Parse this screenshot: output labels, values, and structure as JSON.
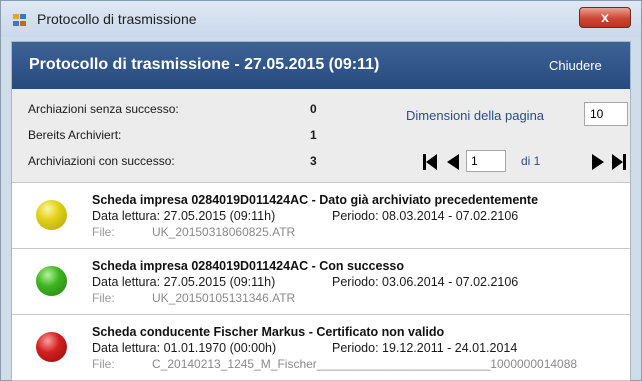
{
  "window": {
    "title": "Protocollo di trasmissione",
    "close_glyph": "x"
  },
  "header": {
    "title": "Protocollo di trasmissione - 27.05.2015 (09:11)",
    "close_label": "Chiudere"
  },
  "summary": {
    "stats": [
      {
        "label": "Archiazioni senza successo:",
        "value": "0"
      },
      {
        "label": "Bereits Archiviert:",
        "value": "1"
      },
      {
        "label": "Archiviazioni con successo:",
        "value": "3"
      }
    ],
    "page_size_label": "Dimensioni della pagina",
    "page_size_value": "10",
    "page_current": "1",
    "page_of": "di 1"
  },
  "entries": [
    {
      "status": "yellow",
      "title": "Scheda impresa 0284019D011424AC - Dato già archiviato precedentemente",
      "date": "Data lettura: 27.05.2015 (09:11h)",
      "period": "Periodo:  08.03.2014 - 07.02.2106",
      "file_label": "File:",
      "file": "UK_20150318060825.ATR"
    },
    {
      "status": "green",
      "title": "Scheda impresa 0284019D011424AC - Con successo",
      "date": "Data lettura: 27.05.2015 (09:11h)",
      "period": "Periodo:  03.06.2014 - 07.02.2106",
      "file_label": "File:",
      "file": "UK_20150105131346.ATR"
    },
    {
      "status": "red",
      "title": "Scheda conducente Fischer Markus - Certificato non valido",
      "date": "Data lettura: 01.01.1970 (00:00h)",
      "period": "Periodo:  19.12.2011 - 24.01.2014",
      "file_label": "File:",
      "file": "C_20140213_1245_M_Fischer__________________________1000000014088"
    }
  ],
  "colors": {
    "header_bg": "#2f5489",
    "link": "#2a4e8a",
    "yellow": "#e2d21b",
    "green": "#3fb521",
    "red": "#d42020"
  }
}
